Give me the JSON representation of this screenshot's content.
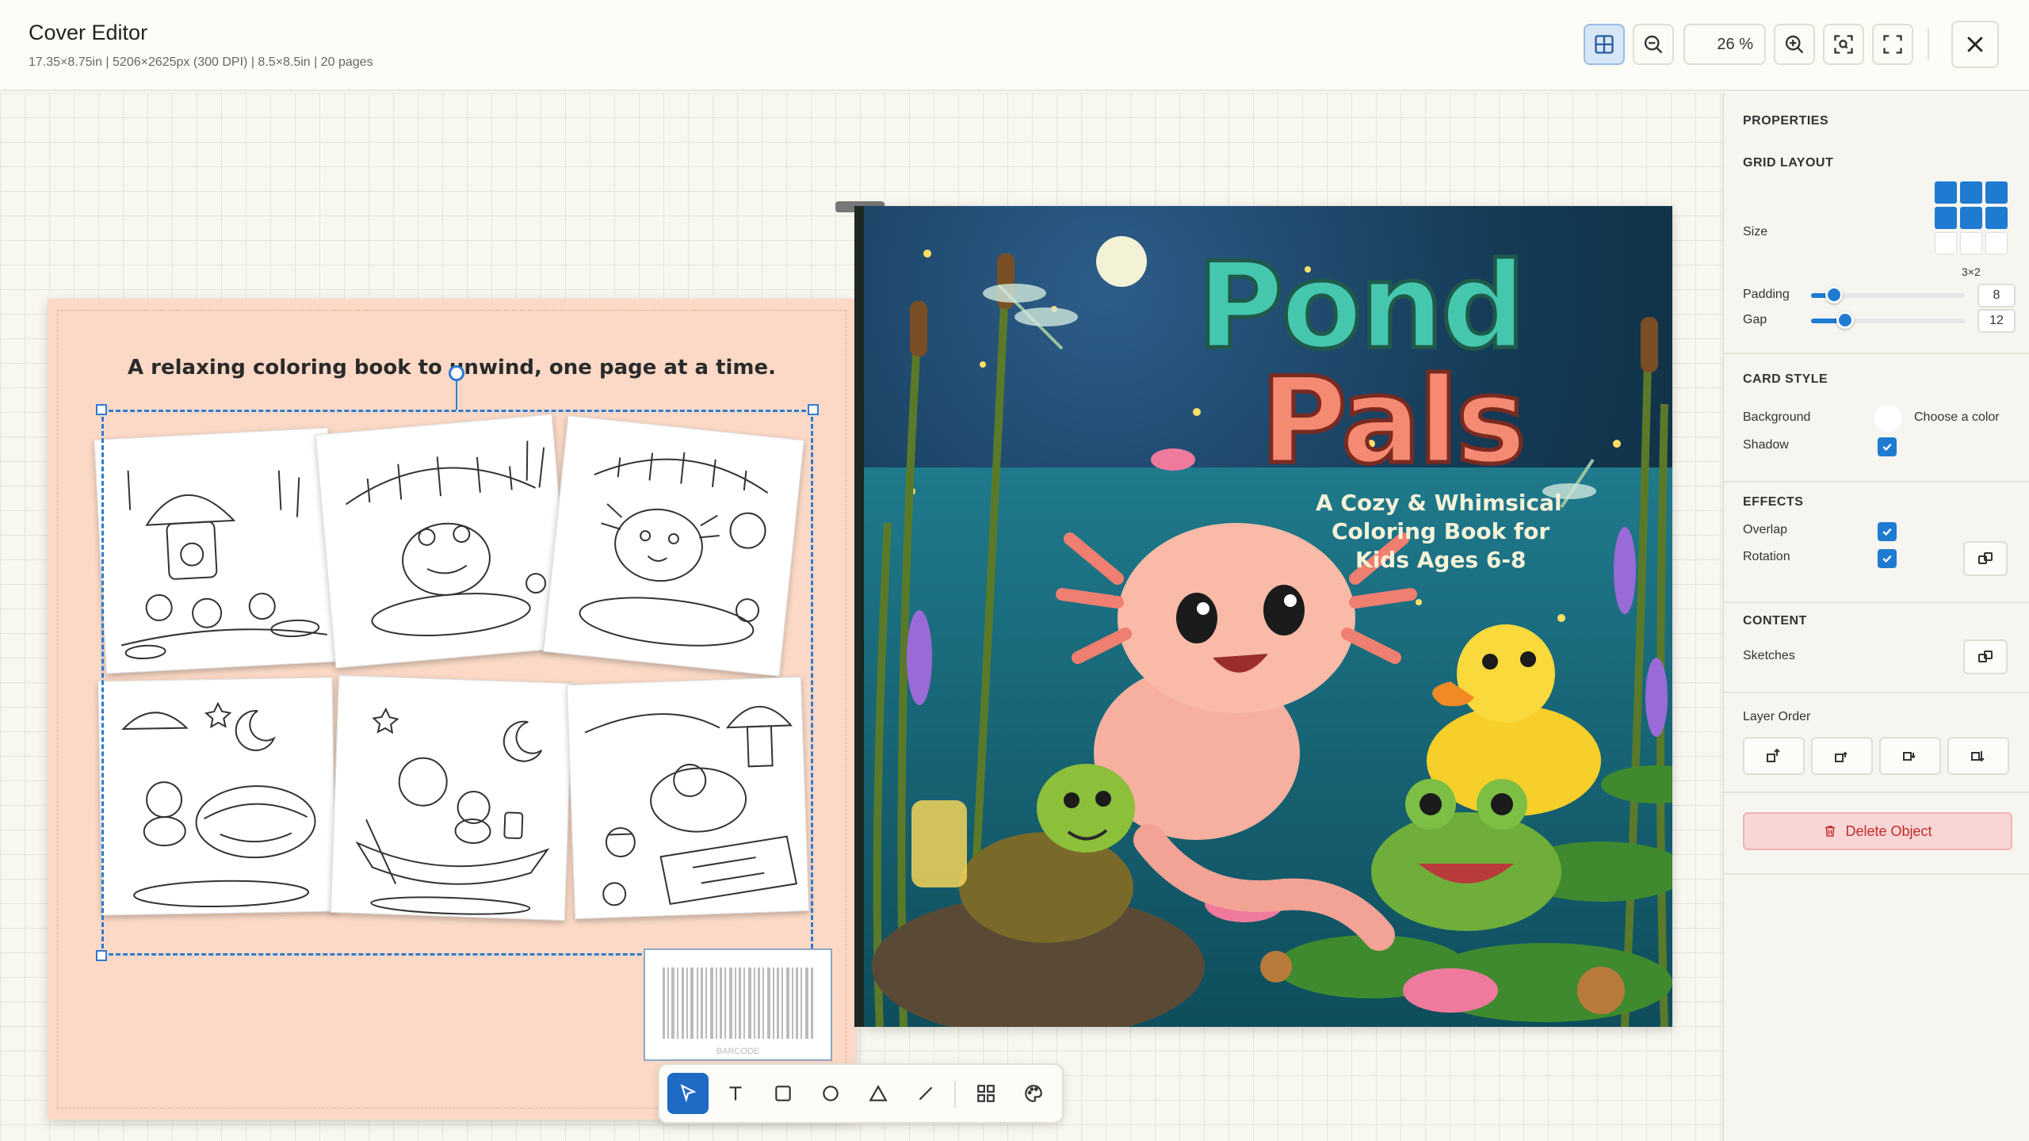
{
  "header": {
    "title": "Cover Editor",
    "meta": "17.35×8.75in | 5206×2625px (300 DPI) | 8.5×8.5in | 20 pages",
    "zoom": "26 %",
    "buttons": {
      "grid_toggle": "grid-icon",
      "zoom_out": "zoom-out-icon",
      "zoom_in": "zoom-in-icon",
      "fit": "fit-screen-icon",
      "fullscreen": "fullscreen-icon",
      "close": "close-icon"
    }
  },
  "back_cover": {
    "tagline": "A relaxing coloring book to unwind, one page at a time.",
    "barcode_label": "BARCODE",
    "sketch_count": 6
  },
  "front_cover": {
    "title_line1": "Pond",
    "title_line2": "Pals",
    "subtitle_line1": "A Cozy & Whimsical",
    "subtitle_line2": "Coloring Book for",
    "subtitle_line3": "Kids Ages 6-8"
  },
  "toolbar": {
    "tools": [
      "select-icon",
      "text-icon",
      "rectangle-icon",
      "circle-icon",
      "triangle-icon",
      "line-icon",
      "grid-layout-icon",
      "palette-icon"
    ],
    "active": "select-icon"
  },
  "panel": {
    "heading": "PROPERTIES",
    "grid_layout": {
      "title": "GRID LAYOUT",
      "size_label": "Size",
      "size_value": "3×2",
      "padding_label": "Padding",
      "padding_value": "8",
      "padding_fraction": 0.15,
      "gap_label": "Gap",
      "gap_value": "12",
      "gap_fraction": 0.22
    },
    "card_style": {
      "title": "CARD STYLE",
      "background_label": "Background",
      "choose_color": "Choose a color",
      "shadow_label": "Shadow",
      "shadow_checked": true
    },
    "effects": {
      "title": "EFFECTS",
      "overlap_label": "Overlap",
      "overlap_checked": true,
      "rotation_label": "Rotation",
      "rotation_checked": true
    },
    "content": {
      "title": "CONTENT",
      "sketches_label": "Sketches",
      "layer_order_label": "Layer Order"
    },
    "delete_label": "Delete Object"
  },
  "colors": {
    "accent": "#1f7ad2",
    "back_cover_bg": "#fbd9c6",
    "title_teal": "#3fbfa6",
    "title_coral": "#f27b62",
    "delete_red": "#c62828"
  }
}
